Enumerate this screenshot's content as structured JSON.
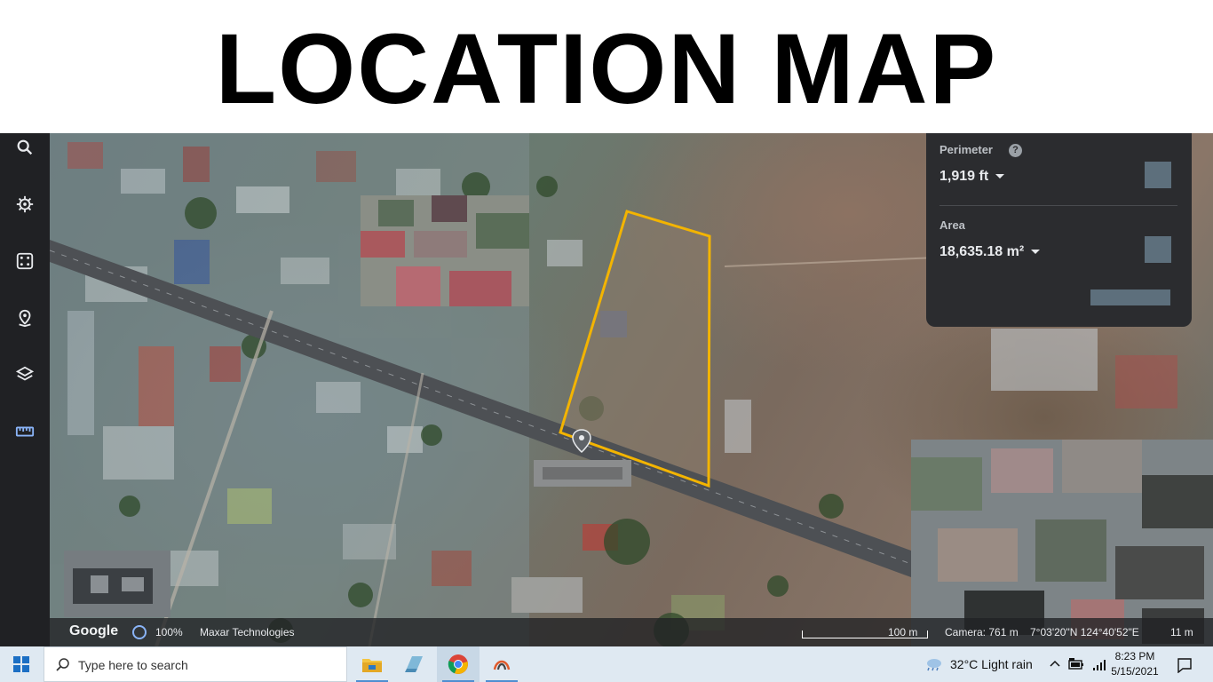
{
  "banner": {
    "title": "LOCATION MAP"
  },
  "rail": {
    "items": [
      {
        "name": "search-icon"
      },
      {
        "name": "voyager-icon"
      },
      {
        "name": "feeling-lucky-icon"
      },
      {
        "name": "projects-icon"
      },
      {
        "name": "map-style-icon"
      },
      {
        "name": "measure-icon"
      }
    ]
  },
  "measure_panel": {
    "perimeter_label": "Perimeter",
    "perimeter_help": "?",
    "perimeter_value": "1,919 ft",
    "area_label": "Area",
    "area_value": "18,635.18 m²"
  },
  "map_status": {
    "logo": "Google",
    "zoom": "100%",
    "attribution": "Maxar Technologies",
    "scale": "100 m",
    "camera": "Camera: 761 m",
    "coordinates": "7°03'20\"N 124°40'52\"E",
    "elevation": "11 m"
  },
  "taskbar": {
    "search_placeholder": "Type here to search",
    "apps": [
      "file-explorer-icon",
      "app-icon",
      "chrome-icon",
      "snip-sketch-icon"
    ],
    "weather": "32°C  Light rain",
    "time": "8:23 PM",
    "date": "5/15/2021"
  },
  "colors": {
    "polygon": "#f3b400",
    "rail_bg": "#202124",
    "panel_bg": "#2b2c2f",
    "taskbar_bg": "#dfe9f2"
  }
}
